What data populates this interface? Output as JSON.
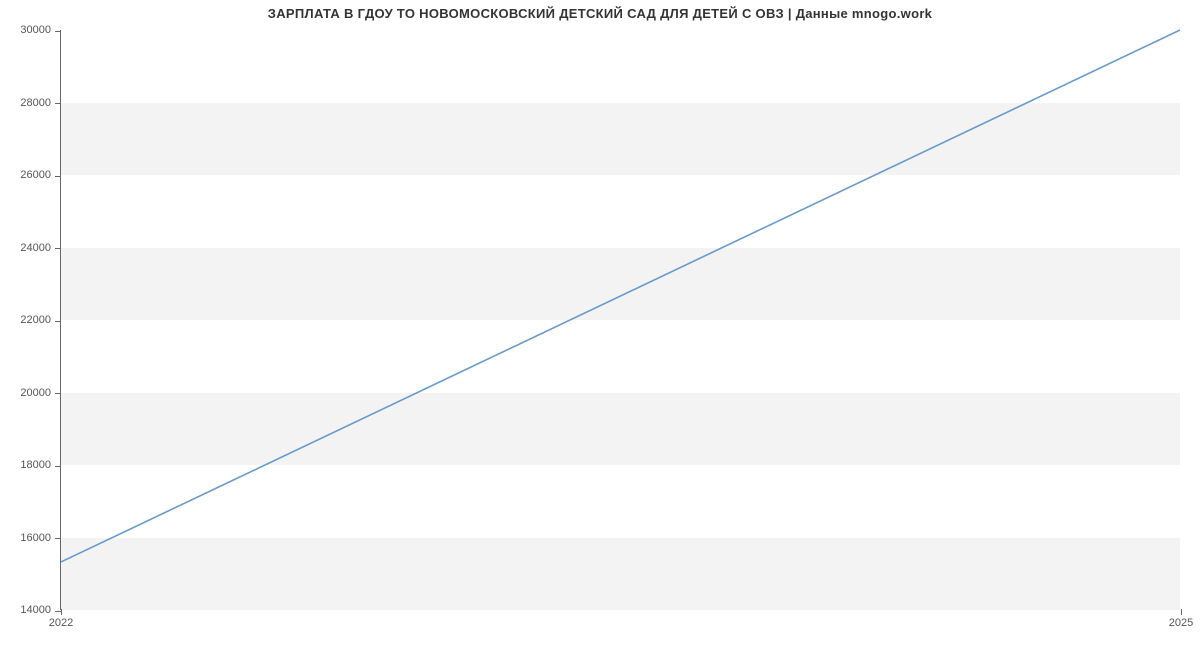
{
  "chart_data": {
    "type": "line",
    "title": "ЗАРПЛАТА В ГДОУ ТО НОВОМОСКОВСКИЙ ДЕТСКИЙ САД ДЛЯ ДЕТЕЙ С ОВЗ | Данные mnogo.work",
    "x": [
      2022,
      2025
    ],
    "y": [
      15300,
      30000
    ],
    "xlabel": "",
    "ylabel": "",
    "x_ticks": [
      2022,
      2025
    ],
    "y_ticks": [
      14000,
      16000,
      18000,
      20000,
      22000,
      24000,
      26000,
      28000,
      30000
    ],
    "y_bands": [
      [
        14000,
        16000
      ],
      [
        18000,
        20000
      ],
      [
        22000,
        24000
      ],
      [
        26000,
        28000
      ]
    ],
    "xlim": [
      2022,
      2025
    ],
    "ylim": [
      14000,
      30000
    ],
    "line_color": "#6699cc"
  }
}
